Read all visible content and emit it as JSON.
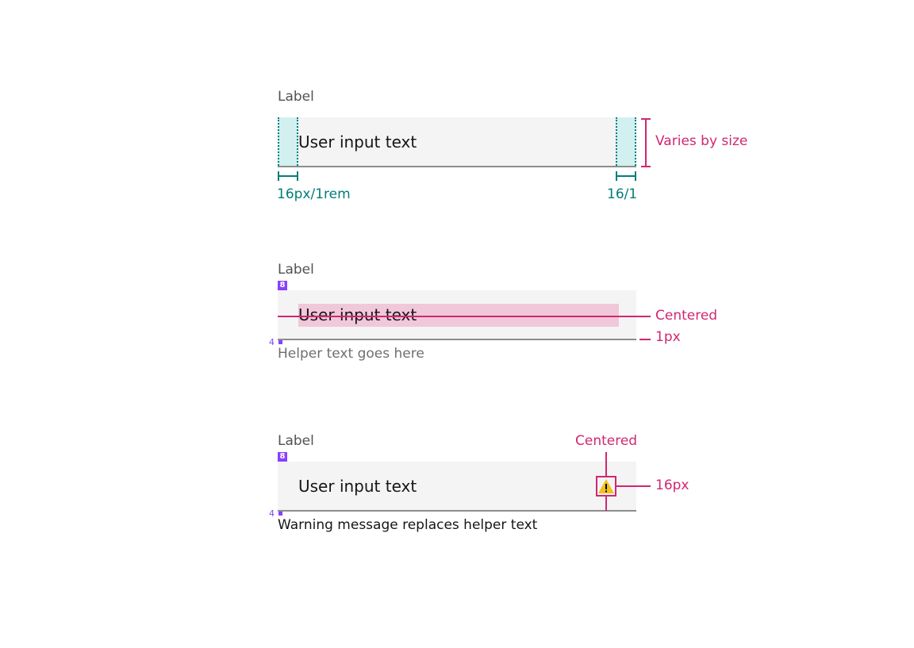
{
  "colors": {
    "field_bg": "#f4f4f4",
    "teal_annotation": "#007d79",
    "pink_annotation": "#d12771",
    "purple_spacing": "#8a3ffc",
    "warning_yellow": "#f1c21b"
  },
  "example1": {
    "label": "Label",
    "input_text": "User input text",
    "left_padding_annotation": "16px/1rem",
    "right_padding_annotation": "16/1",
    "height_annotation": "Varies by size"
  },
  "example2": {
    "label": "Label",
    "spacing_top": "8",
    "input_text": "User input text",
    "spacing_bottom": "4",
    "helper_text": "Helper text goes here",
    "centered_annotation": "Centered",
    "border_annotation": "1px"
  },
  "example3": {
    "label": "Label",
    "spacing_top": "8",
    "input_text": "User input text",
    "spacing_bottom": "4",
    "warning_message": "Warning message replaces helper text",
    "icon": "warning-icon",
    "centered_annotation": "Centered",
    "icon_size_annotation": "16px"
  }
}
